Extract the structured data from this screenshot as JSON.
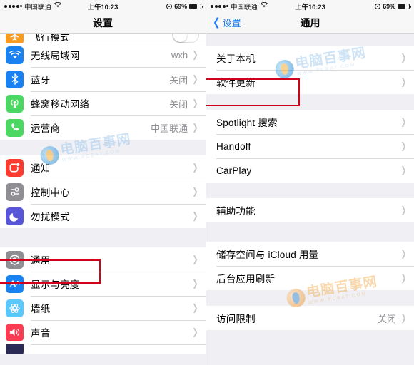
{
  "status_bar": {
    "carrier": "中国联通",
    "wifi_icon": "wifi-icon",
    "time": "上午10:23",
    "battery_percent": "69%",
    "location_icon": "location-icon",
    "signal_dots": 5,
    "signal_filled": 4
  },
  "left_screen": {
    "nav": {
      "title": "设置"
    },
    "groups": [
      {
        "name": "connectivity",
        "rows": [
          {
            "label": "飞行模式",
            "icon": "airplane-icon",
            "icon_color": "#f89c20",
            "accessory": "toggle",
            "cut_off": true
          },
          {
            "label": "无线局域网",
            "icon": "wifi-icon",
            "icon_color": "#1a82f0",
            "value": "wxh",
            "accessory": "chevron"
          },
          {
            "label": "蓝牙",
            "icon": "bluetooth-icon",
            "icon_color": "#1a82f0",
            "value": "关闭",
            "accessory": "chevron"
          },
          {
            "label": "蜂窝移动网络",
            "icon": "cellular-icon",
            "icon_color": "#4cd763",
            "value": "关闭",
            "accessory": "chevron"
          },
          {
            "label": "运营商",
            "icon": "phone-icon",
            "icon_color": "#4cd763",
            "value": "中国联通",
            "accessory": "chevron"
          }
        ]
      },
      {
        "name": "notifications",
        "rows": [
          {
            "label": "通知",
            "icon": "notifications-icon",
            "icon_color": "#fb3b30",
            "value": "",
            "accessory": "chevron"
          },
          {
            "label": "控制中心",
            "icon": "control-center-icon",
            "icon_color": "#8e8e93",
            "value": "",
            "accessory": "chevron"
          },
          {
            "label": "勿扰模式",
            "icon": "moon-icon",
            "icon_color": "#5856d6",
            "value": "",
            "accessory": "chevron"
          }
        ]
      },
      {
        "name": "system",
        "rows": [
          {
            "label": "通用",
            "icon": "gear-icon",
            "icon_color": "#8e8e93",
            "value": "",
            "accessory": "chevron",
            "highlighted": true
          },
          {
            "label": "显示与亮度",
            "icon": "display-icon",
            "icon_color": "#1a82f0",
            "value": "",
            "accessory": "chevron"
          },
          {
            "label": "墙纸",
            "icon": "wallpaper-icon",
            "icon_color": "#5ac8fa",
            "value": "",
            "accessory": "chevron"
          },
          {
            "label": "声音",
            "icon": "sound-icon",
            "icon_color": "#fb3b52",
            "value": "",
            "accessory": "chevron"
          },
          {
            "label": "",
            "icon": "touchid-icon",
            "icon_color": "#2b2a55",
            "value": "",
            "accessory": "chevron",
            "cut_off": true
          }
        ]
      }
    ]
  },
  "right_screen": {
    "nav": {
      "back_label": "设置",
      "back_icon": "chevron-left-icon",
      "title": "通用"
    },
    "groups": [
      {
        "name": "about",
        "rows": [
          {
            "label": "关于本机",
            "value": "",
            "accessory": "chevron"
          },
          {
            "label": "软件更新",
            "value": "",
            "accessory": "chevron",
            "highlighted": true
          }
        ]
      },
      {
        "name": "search-handoff",
        "rows": [
          {
            "label": "Spotlight 搜索",
            "value": "",
            "accessory": "chevron"
          },
          {
            "label": "Handoff",
            "value": "",
            "accessory": "chevron"
          },
          {
            "label": "CarPlay",
            "value": "",
            "accessory": "chevron"
          }
        ]
      },
      {
        "name": "accessibility",
        "rows": [
          {
            "label": "辅助功能",
            "value": "",
            "accessory": "chevron"
          }
        ]
      },
      {
        "name": "storage",
        "rows": [
          {
            "label": "储存空间与 iCloud 用量",
            "value": "",
            "accessory": "chevron"
          },
          {
            "label": "后台应用刷新",
            "value": "",
            "accessory": "chevron"
          }
        ]
      },
      {
        "name": "restrictions",
        "rows": [
          {
            "label": "访问限制",
            "value": "关闭",
            "accessory": "chevron"
          }
        ]
      }
    ]
  },
  "watermark": {
    "main_text": "电脑百事网",
    "sub_text": "WWW.PCBAT.COM"
  },
  "colors": {
    "accent_blue": "#1a7ced",
    "highlight_red": "#d0021b",
    "list_bg": "#efeff4",
    "row_bg": "#ffffff",
    "separator": "#d9d9dc",
    "secondary_text": "#8e8e93"
  }
}
